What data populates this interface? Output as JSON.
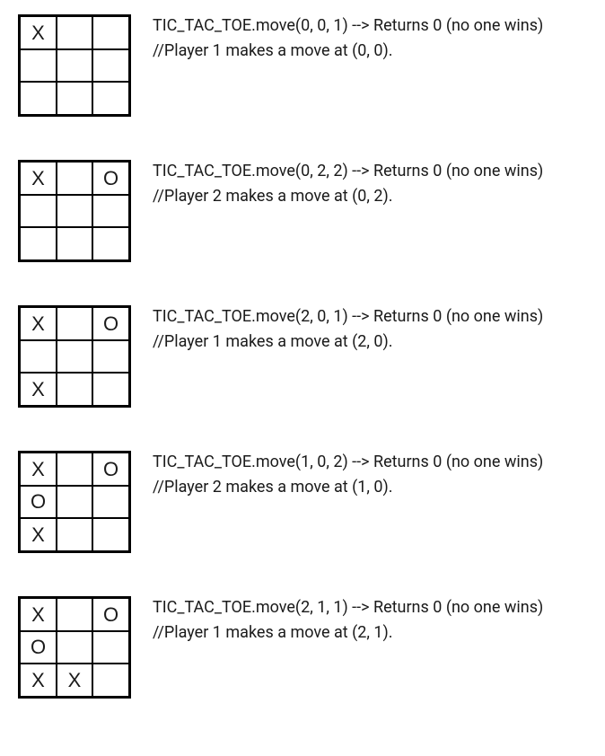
{
  "steps": [
    {
      "grid": [
        [
          "X",
          "",
          ""
        ],
        [
          "",
          "",
          ""
        ],
        [
          "",
          "",
          ""
        ]
      ],
      "call": "TIC_TAC_TOE.move(0, 0, 1) --> Returns 0 (no one wins)",
      "comment": "//Player 1 makes a move at (0, 0)."
    },
    {
      "grid": [
        [
          "X",
          "",
          "O"
        ],
        [
          "",
          "",
          ""
        ],
        [
          "",
          "",
          ""
        ]
      ],
      "call": "TIC_TAC_TOE.move(0, 2, 2) --> Returns 0 (no one wins)",
      "comment": "//Player 2 makes a move at (0, 2)."
    },
    {
      "grid": [
        [
          "X",
          "",
          "O"
        ],
        [
          "",
          "",
          ""
        ],
        [
          "X",
          "",
          ""
        ]
      ],
      "call": "TIC_TAC_TOE.move(2, 0, 1) --> Returns 0 (no one wins)",
      "comment": "//Player 1 makes a move at (2, 0)."
    },
    {
      "grid": [
        [
          "X",
          "",
          "O"
        ],
        [
          "O",
          "",
          ""
        ],
        [
          "X",
          "",
          ""
        ]
      ],
      "call": "TIC_TAC_TOE.move(1, 0, 2) --> Returns 0 (no one wins)",
      "comment": "//Player 2 makes a move at (1, 0)."
    },
    {
      "grid": [
        [
          "X",
          "",
          "O"
        ],
        [
          "O",
          "",
          ""
        ],
        [
          "X",
          "X",
          ""
        ]
      ],
      "call": "TIC_TAC_TOE.move(2, 1, 1) --> Returns 0 (no one wins)",
      "comment": "//Player 1 makes a move at (2, 1)."
    }
  ]
}
